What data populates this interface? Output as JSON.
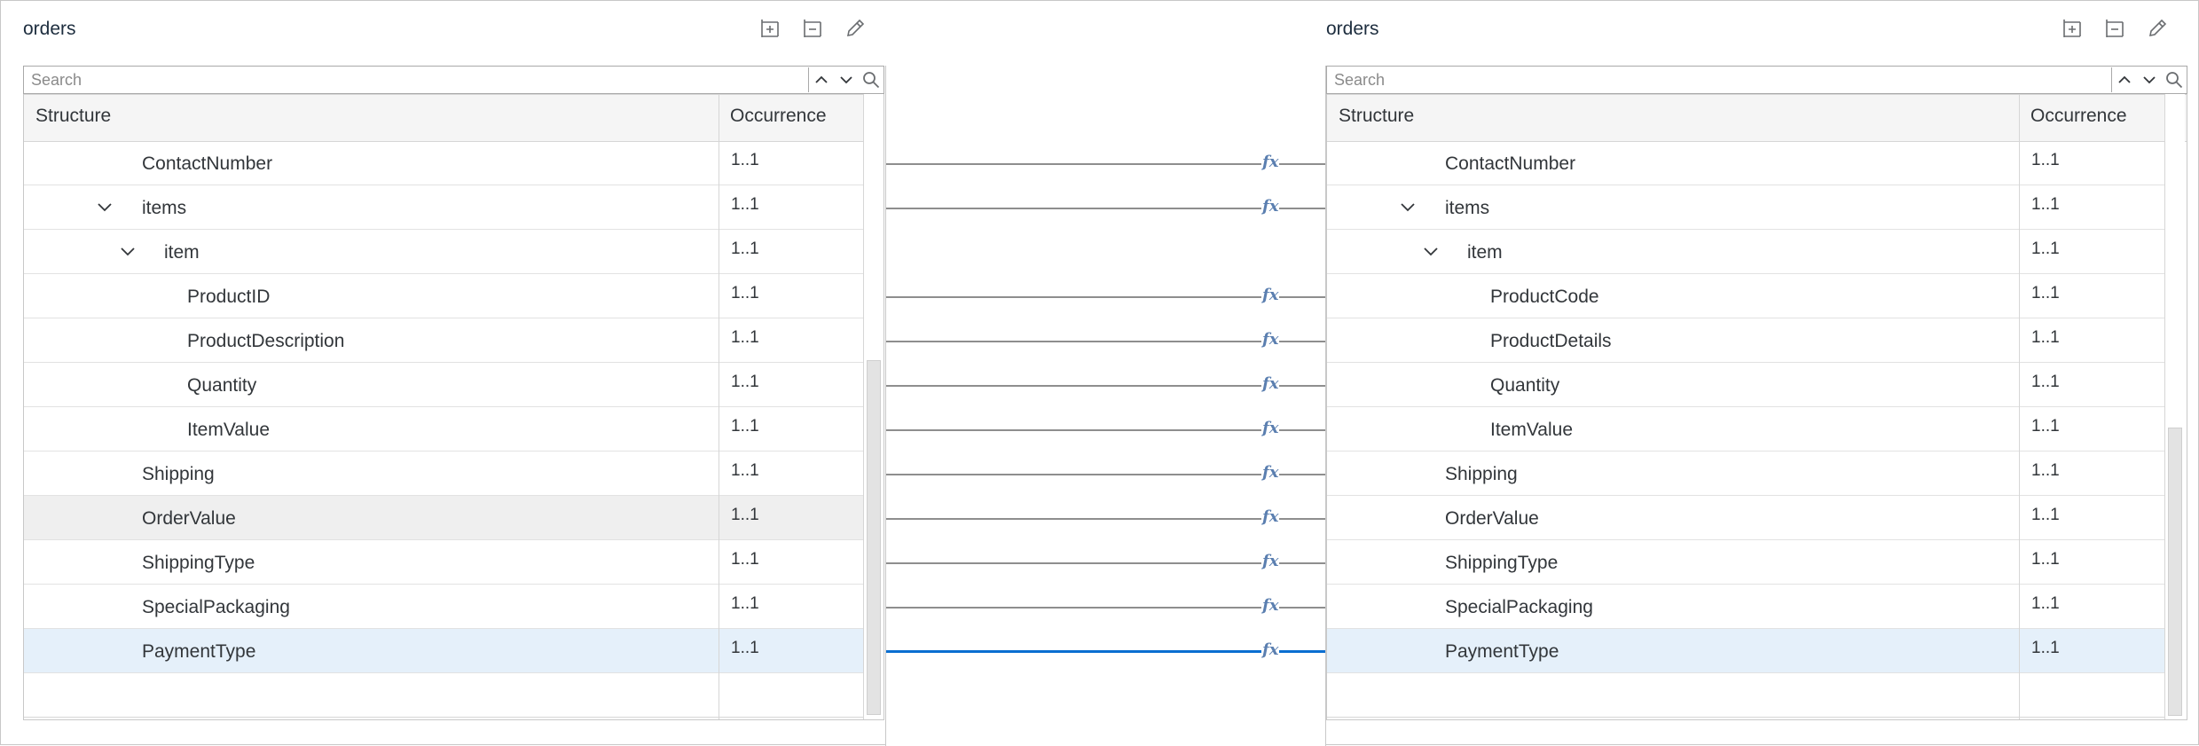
{
  "left": {
    "title": "orders",
    "search_placeholder": "Search",
    "col_structure": "Structure",
    "col_occurrence": "Occurrence",
    "rows": [
      {
        "label": "ContactNumber",
        "occ": "1..1"
      },
      {
        "label": "items",
        "occ": "1..1"
      },
      {
        "label": "item",
        "occ": "1..1"
      },
      {
        "label": "ProductID",
        "occ": "1..1"
      },
      {
        "label": "ProductDescription",
        "occ": "1..1"
      },
      {
        "label": "Quantity",
        "occ": "1..1"
      },
      {
        "label": "ItemValue",
        "occ": "1..1"
      },
      {
        "label": "Shipping",
        "occ": "1..1"
      },
      {
        "label": "OrderValue",
        "occ": "1..1"
      },
      {
        "label": "ShippingType",
        "occ": "1..1"
      },
      {
        "label": "SpecialPackaging",
        "occ": "1..1"
      },
      {
        "label": "PaymentType",
        "occ": "1..1"
      }
    ]
  },
  "right": {
    "title": "orders",
    "search_placeholder": "Search",
    "col_structure": "Structure",
    "col_occurrence": "Occurrence",
    "rows": [
      {
        "label": "ContactNumber",
        "occ": "1..1"
      },
      {
        "label": "items",
        "occ": "1..1"
      },
      {
        "label": "item",
        "occ": "1..1"
      },
      {
        "label": "ProductCode",
        "occ": "1..1"
      },
      {
        "label": "ProductDetails",
        "occ": "1..1"
      },
      {
        "label": "Quantity",
        "occ": "1..1"
      },
      {
        "label": "ItemValue",
        "occ": "1..1"
      },
      {
        "label": "Shipping",
        "occ": "1..1"
      },
      {
        "label": "OrderValue",
        "occ": "1..1"
      },
      {
        "label": "ShippingType",
        "occ": "1..1"
      },
      {
        "label": "SpecialPackaging",
        "occ": "1..1"
      },
      {
        "label": "PaymentType",
        "occ": "1..1"
      }
    ]
  },
  "mapping": {
    "function_label": "fx",
    "mapped_rows": [
      "ContactNumber",
      "items",
      "ProductID",
      "ProductDescription",
      "Quantity",
      "ItemValue",
      "Shipping",
      "OrderValue",
      "ShippingType",
      "SpecialPackaging",
      "PaymentType"
    ],
    "active_row": "PaymentType"
  },
  "colors": {
    "selected_row": "#e5f0fa",
    "hover_row": "#efefef",
    "active_line": "#0a6ed1",
    "line": "#8e8e8e",
    "fx": "#5b7fb0"
  },
  "icons": [
    "add-node-icon",
    "remove-node-icon",
    "edit-icon",
    "chevron-up-icon",
    "chevron-down-icon",
    "search-icon",
    "function-icon"
  ]
}
